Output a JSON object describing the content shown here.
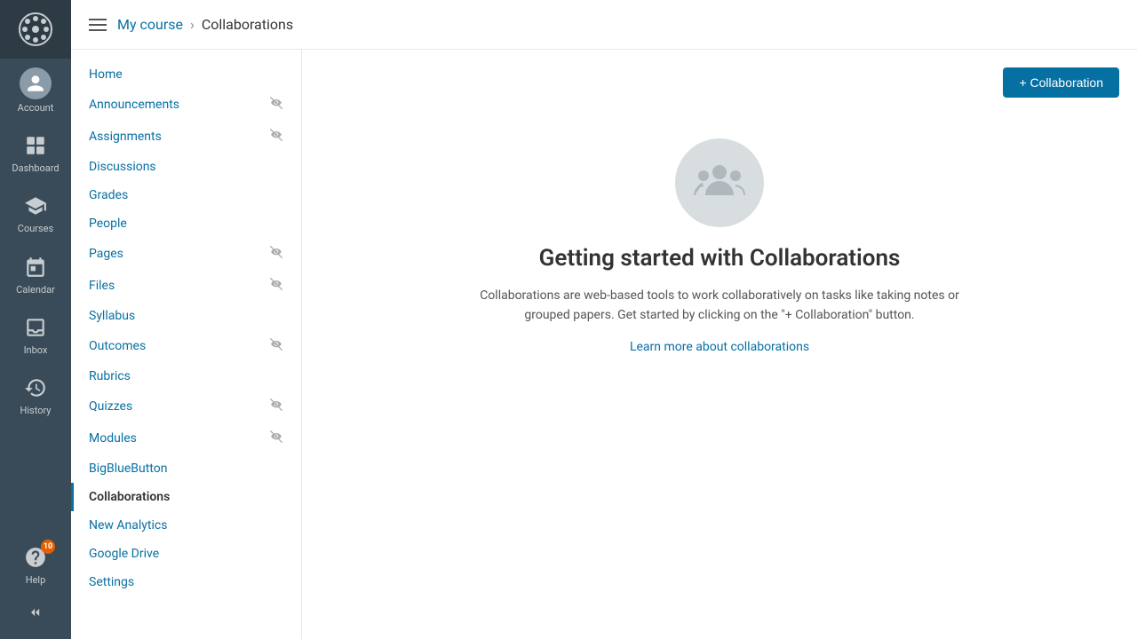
{
  "globalNav": {
    "logo": "canvas-logo",
    "items": [
      {
        "id": "account",
        "label": "Account",
        "icon": "account-icon"
      },
      {
        "id": "dashboard",
        "label": "Dashboard",
        "icon": "dashboard-icon"
      },
      {
        "id": "courses",
        "label": "Courses",
        "icon": "courses-icon"
      },
      {
        "id": "calendar",
        "label": "Calendar",
        "icon": "calendar-icon"
      },
      {
        "id": "inbox",
        "label": "Inbox",
        "icon": "inbox-icon"
      },
      {
        "id": "history",
        "label": "History",
        "icon": "history-icon"
      },
      {
        "id": "help",
        "label": "Help",
        "icon": "help-icon",
        "badge": "10"
      }
    ],
    "collapse_label": "Collapse"
  },
  "breadcrumb": {
    "parent_label": "My course",
    "current_label": "Collaborations",
    "separator": "›"
  },
  "topbar": {
    "hamburger_title": "Toggle menu"
  },
  "courseNav": {
    "items": [
      {
        "id": "home",
        "label": "Home",
        "active": false,
        "has_eye": false
      },
      {
        "id": "announcements",
        "label": "Announcements",
        "active": false,
        "has_eye": true
      },
      {
        "id": "assignments",
        "label": "Assignments",
        "active": false,
        "has_eye": true
      },
      {
        "id": "discussions",
        "label": "Discussions",
        "active": false,
        "has_eye": false
      },
      {
        "id": "grades",
        "label": "Grades",
        "active": false,
        "has_eye": false
      },
      {
        "id": "people",
        "label": "People",
        "active": false,
        "has_eye": false
      },
      {
        "id": "pages",
        "label": "Pages",
        "active": false,
        "has_eye": true
      },
      {
        "id": "files",
        "label": "Files",
        "active": false,
        "has_eye": true
      },
      {
        "id": "syllabus",
        "label": "Syllabus",
        "active": false,
        "has_eye": false
      },
      {
        "id": "outcomes",
        "label": "Outcomes",
        "active": false,
        "has_eye": true
      },
      {
        "id": "rubrics",
        "label": "Rubrics",
        "active": false,
        "has_eye": false
      },
      {
        "id": "quizzes",
        "label": "Quizzes",
        "active": false,
        "has_eye": true
      },
      {
        "id": "modules",
        "label": "Modules",
        "active": false,
        "has_eye": true
      },
      {
        "id": "bigbluebutton",
        "label": "BigBlueButton",
        "active": false,
        "has_eye": false
      },
      {
        "id": "collaborations",
        "label": "Collaborations",
        "active": true,
        "has_eye": false
      },
      {
        "id": "new-analytics",
        "label": "New Analytics",
        "active": false,
        "has_eye": false
      },
      {
        "id": "google-drive",
        "label": "Google Drive",
        "active": false,
        "has_eye": false
      },
      {
        "id": "settings",
        "label": "Settings",
        "active": false,
        "has_eye": false
      }
    ]
  },
  "pageContent": {
    "add_button_label": "+ Collaboration",
    "icon_alt": "Collaborations group icon",
    "title": "Getting started with Collaborations",
    "description": "Collaborations are web-based tools to work collaboratively on tasks like taking notes or grouped papers. Get started by clicking on the \"+ Collaboration\" button.",
    "link_label": "Learn more about collaborations",
    "link_href": "#"
  },
  "colors": {
    "accent": "#0770a3",
    "nav_bg": "#394b58",
    "active_border": "#0770a3"
  }
}
